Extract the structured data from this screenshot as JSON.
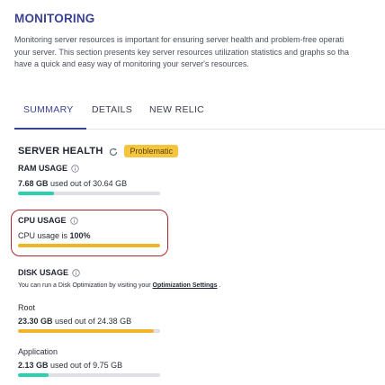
{
  "page": {
    "title": "MONITORING",
    "description_lines": [
      "Monitoring server resources is important for ensuring server health and problem-free operati",
      "your server. This section presents key server resources utilization statistics and graphs so tha",
      "have a quick and easy way of monitoring your server's resources."
    ]
  },
  "tabs": [
    {
      "label": "SUMMARY",
      "active": true
    },
    {
      "label": "DETAILS",
      "active": false
    },
    {
      "label": "NEW RELIC",
      "active": false
    }
  ],
  "server_health": {
    "title": "SERVER HEALTH",
    "status_badge": "Problematic",
    "badge_color": "#f6c53e"
  },
  "ram": {
    "label": "RAM USAGE",
    "used": "7.68 GB",
    "mid_text": " used out of ",
    "total": "30.64 GB",
    "fraction": 0.25,
    "bar_color": "#2ad0b0"
  },
  "cpu": {
    "label": "CPU USAGE",
    "prefix": "CPU usage is ",
    "value": "100%",
    "fraction": 1.0,
    "bar_color": "#f0b429"
  },
  "disk": {
    "label": "DISK USAGE",
    "note_prefix": "You can run a Disk Optimization by visiting your ",
    "note_link": "Optimization Settings",
    "note_suffix": " .",
    "partitions": [
      {
        "name": "Root",
        "used": "23.30 GB",
        "mid_text": " used out of ",
        "total": "24.38 GB",
        "fraction": 0.956,
        "bar_color": "#f0b429"
      },
      {
        "name": "Application",
        "used": "2.13 GB",
        "mid_text": " used out of ",
        "total": "9.75 GB",
        "fraction": 0.218,
        "bar_color": "#2ad0b0"
      }
    ]
  },
  "colors": {
    "accent": "#3c4293",
    "highlight_ring": "#b2252f",
    "bar_track": "#dfe0e4"
  }
}
